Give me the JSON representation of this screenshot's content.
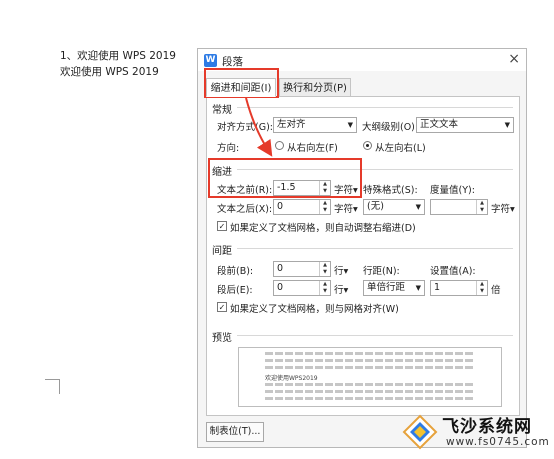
{
  "document": {
    "line1": "1、欢迎使用 WPS 2019",
    "line2": "欢迎使用 WPS 2019"
  },
  "dialog": {
    "title": "段落",
    "close": "×",
    "tabs": [
      {
        "label": "缩进和间距(I)",
        "active": true
      },
      {
        "label": "换行和分页(P)",
        "active": false
      }
    ],
    "general": {
      "section": "常规",
      "alignment_label": "对齐方式(G):",
      "alignment_value": "左对齐",
      "outline_label": "大纲级别(O):",
      "outline_value": "正文文本",
      "direction_label": "方向:",
      "rtl_label": "从右向左(F)",
      "ltr_label": "从左向右(L)",
      "ltr_selected": true
    },
    "indent": {
      "section": "缩进",
      "before_label": "文本之前(R):",
      "before_value": "-1.5",
      "before_unit": "字符",
      "after_label": "文本之后(X):",
      "after_value": "0",
      "after_unit": "字符",
      "special_label": "特殊格式(S):",
      "special_value": "(无)",
      "measure_label": "度量值(Y):",
      "measure_value": "",
      "measure_unit": "字符",
      "grid_check_label": "如果定义了文档网格，则自动调整右缩进(D)",
      "grid_checked": true
    },
    "spacing": {
      "section": "间距",
      "before_label": "段前(B):",
      "before_value": "0",
      "before_unit": "行",
      "after_label": "段后(E):",
      "after_value": "0",
      "after_unit": "行",
      "line_label": "行距(N):",
      "line_value": "单倍行距",
      "setting_label": "设置值(A):",
      "setting_value": "1",
      "setting_unit": "倍",
      "grid_check_label": "如果定义了文档网格，则与网格对齐(W)",
      "grid_checked": true
    },
    "preview": {
      "section": "预览",
      "sample_text": "欢迎使用WPS2019"
    },
    "tabstops_button": "制表位(T)..."
  },
  "watermark": {
    "title": "飞沙系统网",
    "url": "www.fs0745.com"
  },
  "colors": {
    "highlight": "#e53a2a",
    "app_icon": "#2d7be5"
  }
}
